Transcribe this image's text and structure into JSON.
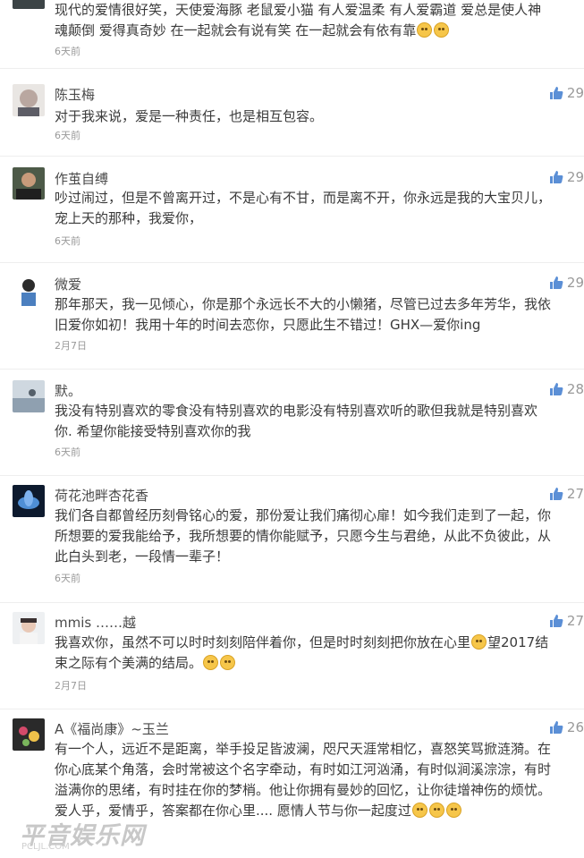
{
  "comments": [
    {
      "username": "",
      "lines": [
        "现代的爱情很好笑，天使爱海豚 老鼠爱小猫 有人爱温柔  有人爱霸道 爱总是使人神",
        "魂颠倒 爱得真奇妙 在一起就会有说有笑 在一起就会有依有靠"
      ],
      "emoji_after_last_line": 2,
      "time": "6天前",
      "likes": ""
    },
    {
      "username": "陈玉梅",
      "lines": [
        "对于我来说，爱是一种责任，也是相互包容。"
      ],
      "emoji_after_last_line": 0,
      "time": "6天前",
      "likes": "29"
    },
    {
      "username": "作茧自缚",
      "lines": [
        "吵过闹过，但是不曾离开过，不是心有不甘，而是离不开，你永远是我的大宝贝儿，",
        "宠上天的那种，我爱你，"
      ],
      "emoji_after_last_line": 0,
      "time": "6天前",
      "likes": "29"
    },
    {
      "username": "微爱",
      "lines": [
        "那年那天，我一见倾心，你是那个永远长不大的小懒猪，尽管已过去多年芳华，我依",
        "旧爱你如初！我用十年的时间去恋你，只愿此生不错过！GHX—爱你ing"
      ],
      "emoji_after_last_line": 0,
      "time": "2月7日",
      "likes": "29"
    },
    {
      "username": "默。",
      "lines": [
        "我没有特别喜欢的零食没有特别喜欢的电影没有特别喜欢听的歌但我就是特别喜欢",
        "你. 希望你能接受特别喜欢你的我"
      ],
      "emoji_after_last_line": 0,
      "time": "6天前",
      "likes": "28"
    },
    {
      "username": "荷花池畔杏花香",
      "lines": [
        "我们各自都曾经历刻骨铭心的爱，那份爱让我们痛彻心扉！如今我们走到了一起，你",
        "所想要的爱我能给予，我所想要的情你能赋予，只愿今生与君绝，从此不负彼此，从",
        "此白头到老，一段情一辈子！"
      ],
      "emoji_after_last_line": 0,
      "time": "6天前",
      "likes": "27"
    },
    {
      "username": "mmis ……越",
      "lines": [
        "我喜欢你，虽然不可以时时刻刻陪伴着你，但是时时刻刻把你放在心里",
        "望2017结",
        "束之际有个美满的结局。"
      ],
      "emoji_after_last_line": 2,
      "time": "2月7日",
      "likes": "27"
    },
    {
      "username": "A《福尚康》~玉兰",
      "lines": [
        "有一个人，远近不是距离，举手投足皆波澜，咫尺天涯常相忆，喜怒笑骂掀涟漪。在",
        "你心底某个角落，会时常被这个名字牵动，有时如江河汹涌，有时似涧溪淙淙，有时",
        "溢满你的思绪，有时挂在你的梦梢。他让你拥有曼妙的回忆，让你徒增神伤的烦忧。",
        "爱人乎，爱情乎，答案都在你心里.... 愿情人节与你一起度过"
      ],
      "emoji_after_last_line": 3,
      "time": "",
      "likes": "26"
    }
  ],
  "watermark": {
    "text": "平音娱乐网",
    "sub": "PCLJL.COM"
  },
  "colors": {
    "like_icon": "#5b8fd6",
    "username": "#4a4a4a",
    "time": "#999999"
  }
}
